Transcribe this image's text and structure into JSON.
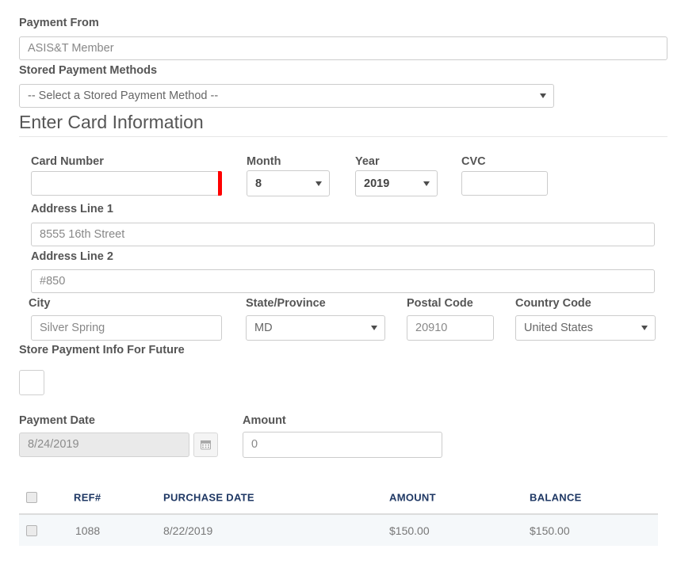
{
  "form": {
    "payment_from": {
      "label": "Payment From",
      "value": "ASIS&T Member"
    },
    "stored_payment_methods": {
      "label": "Stored Payment Methods",
      "value": "-- Select a Stored Payment Method --"
    },
    "card_section": {
      "heading": "Enter Card Information",
      "card_number": {
        "label": "Card Number",
        "value": ""
      },
      "month": {
        "label": "Month",
        "value": "8"
      },
      "year": {
        "label": "Year",
        "value": "2019"
      },
      "cvc": {
        "label": "CVC",
        "value": ""
      },
      "address_line_1": {
        "label": "Address Line 1",
        "value": "8555 16th Street"
      },
      "address_line_2": {
        "label": "Address Line 2",
        "value": "#850"
      },
      "city": {
        "label": "City",
        "value": "Silver Spring"
      },
      "state": {
        "label": "State/Province",
        "value": "MD"
      },
      "postal_code": {
        "label": "Postal Code",
        "value": "20910"
      },
      "country_code": {
        "label": "Country Code",
        "value": "United States"
      },
      "store_info": {
        "label": "Store Payment Info For Future",
        "checked": false
      }
    },
    "payment_date": {
      "label": "Payment Date",
      "value": "8/24/2019"
    },
    "amount": {
      "label": "Amount",
      "value": "0"
    }
  },
  "table": {
    "columns": [
      "REF#",
      "PURCHASE DATE",
      "AMOUNT",
      "BALANCE"
    ],
    "rows": [
      {
        "ref": "1088",
        "purchase_date": "8/22/2019",
        "amount": "$150.00",
        "balance": "$150.00"
      }
    ]
  },
  "colors": {
    "required_marker": "#ff0000",
    "table_header_text": "#1f3864",
    "row_background": "#f5f8fa",
    "label_text": "#555555"
  }
}
